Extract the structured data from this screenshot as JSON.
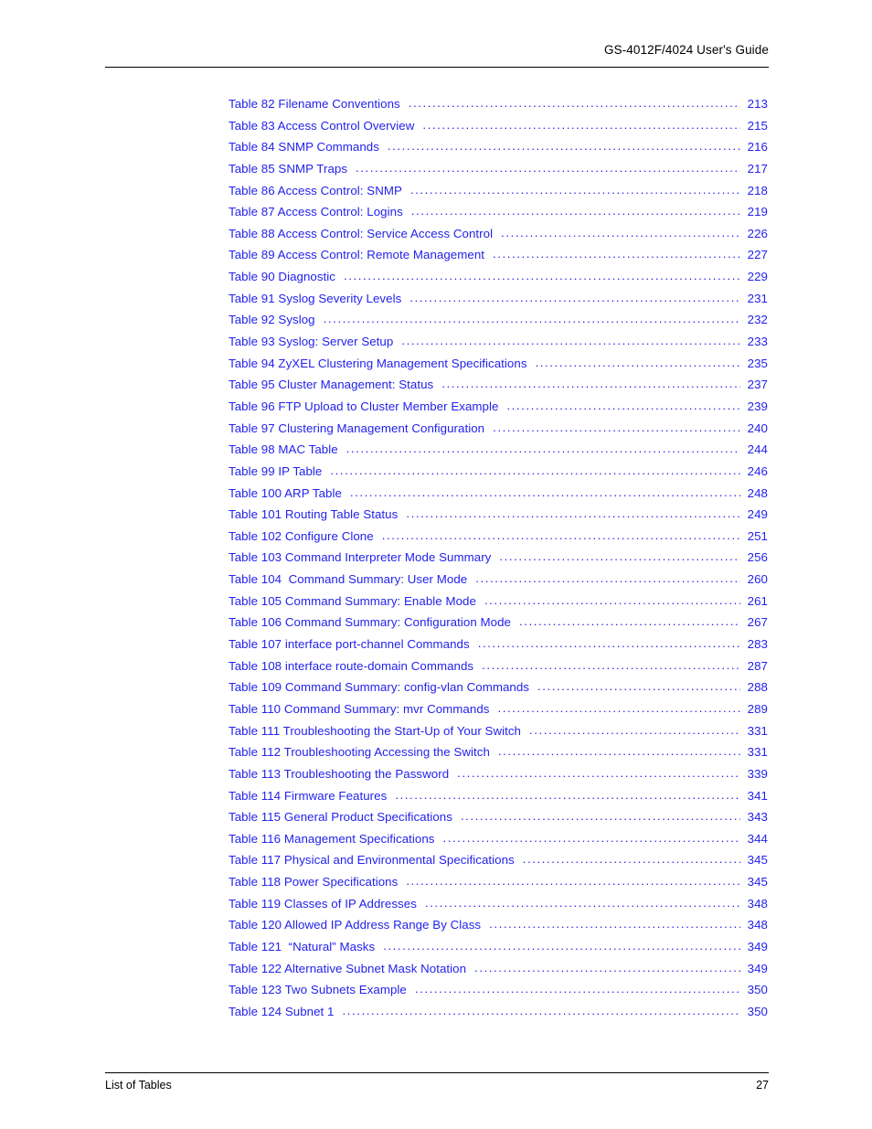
{
  "header": {
    "title": "GS-4012F/4024 User's Guide"
  },
  "footer": {
    "section": "List of Tables",
    "page_number": "27"
  },
  "colors": {
    "entry_blue": "#2222ee",
    "text_black": "#000000",
    "rule_black": "#000000",
    "background": "#ffffff"
  },
  "leader": {
    "dots": "..................................................................................................................."
  },
  "toc": {
    "entries": [
      {
        "label": "Table 82 Filename Conventions",
        "page": "213"
      },
      {
        "label": "Table 83 Access Control Overview",
        "page": "215"
      },
      {
        "label": "Table 84 SNMP Commands",
        "page": "216"
      },
      {
        "label": "Table 85 SNMP Traps",
        "page": "217"
      },
      {
        "label": "Table 86 Access Control: SNMP",
        "page": "218"
      },
      {
        "label": "Table 87 Access Control: Logins",
        "page": "219"
      },
      {
        "label": "Table 88 Access Control: Service Access Control",
        "page": "226"
      },
      {
        "label": "Table 89 Access Control: Remote Management",
        "page": "227"
      },
      {
        "label": "Table 90 Diagnostic",
        "page": "229"
      },
      {
        "label": "Table 91 Syslog Severity Levels",
        "page": "231"
      },
      {
        "label": "Table 92 Syslog",
        "page": "232"
      },
      {
        "label": "Table 93 Syslog: Server Setup",
        "page": "233"
      },
      {
        "label": "Table 94 ZyXEL Clustering Management Specifications",
        "page": "235"
      },
      {
        "label": "Table 95 Cluster Management: Status",
        "page": "237"
      },
      {
        "label": "Table 96 FTP Upload to Cluster Member Example",
        "page": "239"
      },
      {
        "label": "Table 97 Clustering Management Configuration",
        "page": "240"
      },
      {
        "label": "Table 98 MAC Table",
        "page": "244"
      },
      {
        "label": "Table 99 IP Table",
        "page": "246"
      },
      {
        "label": "Table 100 ARP Table",
        "page": "248"
      },
      {
        "label": "Table 101 Routing Table Status",
        "page": "249"
      },
      {
        "label": "Table 102 Configure Clone",
        "page": "251"
      },
      {
        "label": "Table 103 Command Interpreter Mode Summary",
        "page": "256"
      },
      {
        "label": "Table 104  Command Summary: User Mode",
        "page": "260"
      },
      {
        "label": "Table 105 Command Summary: Enable Mode",
        "page": "261"
      },
      {
        "label": "Table 106 Command Summary: Configuration Mode",
        "page": "267"
      },
      {
        "label": "Table 107 interface port-channel Commands",
        "page": "283"
      },
      {
        "label": "Table 108 interface route-domain Commands",
        "page": "287"
      },
      {
        "label": "Table 109 Command Summary: config-vlan Commands",
        "page": "288"
      },
      {
        "label": "Table 110 Command Summary: mvr Commands",
        "page": "289"
      },
      {
        "label": "Table 111 Troubleshooting the Start-Up of Your Switch",
        "page": "331"
      },
      {
        "label": "Table 112 Troubleshooting Accessing the Switch",
        "page": "331"
      },
      {
        "label": "Table 113 Troubleshooting the Password",
        "page": "339"
      },
      {
        "label": "Table 114 Firmware Features",
        "page": "341"
      },
      {
        "label": "Table 115 General Product Specifications",
        "page": "343"
      },
      {
        "label": "Table 116 Management Specifications",
        "page": "344"
      },
      {
        "label": "Table 117 Physical and Environmental Specifications",
        "page": "345"
      },
      {
        "label": "Table 118 Power Specifications",
        "page": "345"
      },
      {
        "label": "Table 119 Classes of IP Addresses",
        "page": "348"
      },
      {
        "label": "Table 120 Allowed IP Address Range By Class",
        "page": "348"
      },
      {
        "label": "Table 121  “Natural” Masks",
        "page": "349"
      },
      {
        "label": "Table 122 Alternative Subnet Mask Notation",
        "page": "349"
      },
      {
        "label": "Table 123 Two Subnets Example",
        "page": "350"
      },
      {
        "label": "Table 124 Subnet 1",
        "page": "350"
      }
    ]
  }
}
